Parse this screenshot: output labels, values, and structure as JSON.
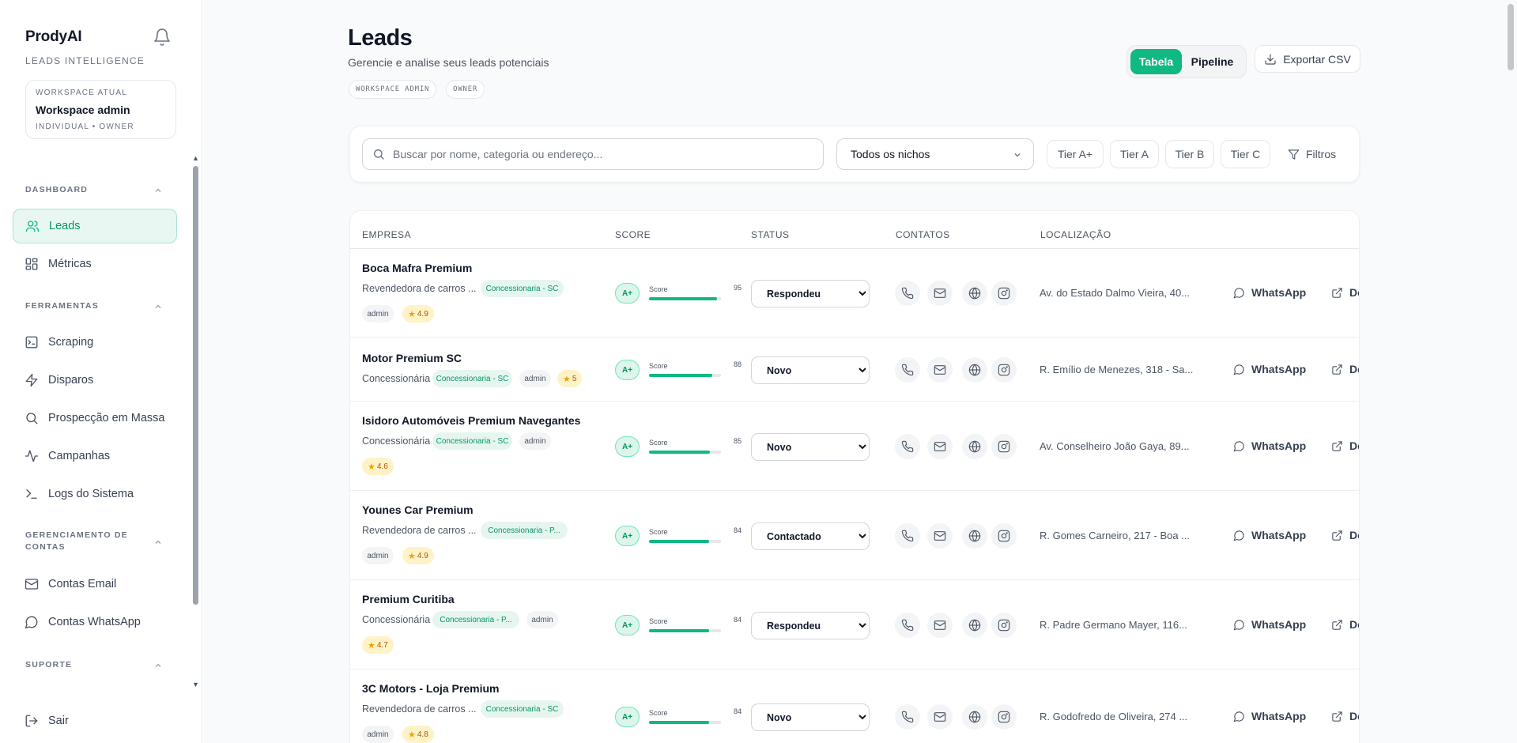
{
  "sidebar": {
    "brand": "ProdyAI",
    "brand_sub": "LEADS INTELLIGENCE",
    "workspace": {
      "label": "WORKSPACE ATUAL",
      "name": "Workspace admin",
      "meta": "INDIVIDUAL • OWNER"
    },
    "sections": {
      "dashboard": "DASHBOARD",
      "ferramentas": "FERRAMENTAS",
      "contas": "GERENCIAMENTO DE CONTAS",
      "suporte": "SUPORTE"
    },
    "items": {
      "leads": "Leads",
      "metricas": "Métricas",
      "scraping": "Scraping",
      "disparos": "Disparos",
      "prospeccao": "Prospecção em Massa",
      "campanhas": "Campanhas",
      "logs": "Logs do Sistema",
      "email": "Contas Email",
      "whatsapp": "Contas WhatsApp",
      "sair": "Sair"
    }
  },
  "header": {
    "title": "Leads",
    "subtitle": "Gerencie e analise seus leads potenciais",
    "tags": [
      "WORKSPACE ADMIN",
      "OWNER"
    ],
    "view_table": "Tabela",
    "view_pipeline": "Pipeline",
    "export": "Exportar CSV"
  },
  "filters": {
    "search_placeholder": "Buscar por nome, categoria ou endereço...",
    "nicho": "Todos os nichos",
    "tiers": [
      "Tier A+",
      "Tier A",
      "Tier B",
      "Tier C"
    ],
    "filtros": "Filtros"
  },
  "table": {
    "columns": {
      "empresa": "EMPRESA",
      "score": "SCORE",
      "status": "STATUS",
      "contatos": "CONTATOS",
      "localizacao": "LOCALIZAÇÃO"
    },
    "score_label": "Score",
    "whatsapp_label": "WhatsApp",
    "details_label": "De",
    "status_options": [
      "Novo",
      "Contactado",
      "Respondeu"
    ],
    "rows": [
      {
        "name": "Boca Mafra Premium",
        "category": "Revendedora de carros ...",
        "niche": "Concessionaria - SC",
        "admin": "admin",
        "rating": "4.9",
        "tier": "A+",
        "score": 95,
        "status": "Respondeu",
        "location": "Av. do Estado Dalmo Vieira, 40..."
      },
      {
        "name": "Motor Premium SC",
        "category": "Concessionária",
        "niche": "Concessionaria - SC",
        "admin": "admin",
        "rating": "5",
        "tier": "A+",
        "score": 88,
        "status": "Novo",
        "location": "R. Emílio de Menezes, 318 - Sa..."
      },
      {
        "name": "Isidoro Automóveis Premium Navegantes",
        "category": "Concessionária",
        "niche": "Concessionaria - SC",
        "admin": "admin",
        "rating": "4.6",
        "tier": "A+",
        "score": 85,
        "status": "Novo",
        "location": "Av. Conselheiro João Gaya, 89..."
      },
      {
        "name": "Younes Car Premium",
        "category": "Revendedora de carros ...",
        "niche": "Concessionaria - P...",
        "admin": "admin",
        "rating": "4.9",
        "tier": "A+",
        "score": 84,
        "status": "Contactado",
        "location": "R. Gomes Carneiro, 217 - Boa ..."
      },
      {
        "name": "Premium Curitiba",
        "category": "Concessionária",
        "niche": "Concessionaria - P...",
        "admin": "admin",
        "rating": "4.7",
        "tier": "A+",
        "score": 84,
        "status": "Respondeu",
        "location": "R. Padre Germano Mayer, 116..."
      },
      {
        "name": "3C Motors - Loja Premium",
        "category": "Revendedora de carros ...",
        "niche": "Concessionaria - SC",
        "admin": "admin",
        "rating": "4.8",
        "tier": "A+",
        "score": 84,
        "status": "Novo",
        "location": "R. Godofredo de Oliveira, 274 ..."
      }
    ]
  },
  "colors": {
    "accent": "#10b981",
    "accent_dark": "#059669",
    "star": "#f59e0b"
  }
}
